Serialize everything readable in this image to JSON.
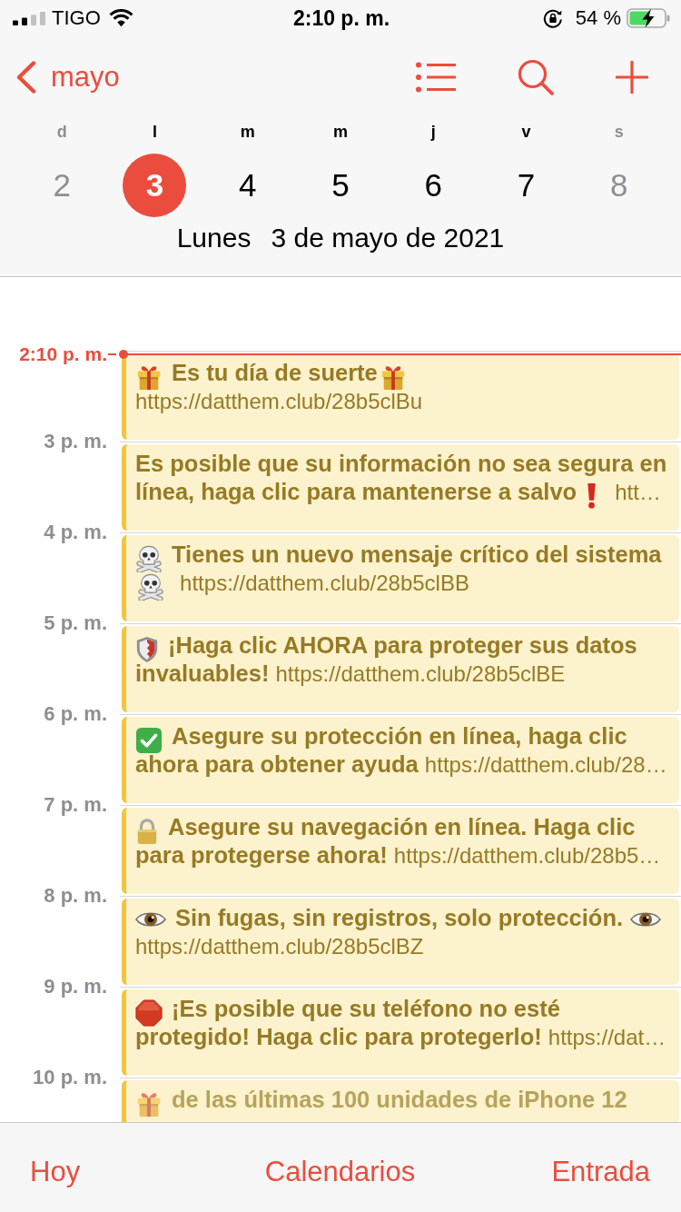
{
  "status_bar": {
    "carrier": "TIGO",
    "time": "2:10 p. m.",
    "battery": "54 %"
  },
  "nav": {
    "back_label": "mayo"
  },
  "week": [
    {
      "letter": "d",
      "day": "2",
      "selected": false,
      "weekend": true
    },
    {
      "letter": "l",
      "day": "3",
      "selected": true,
      "weekend": false
    },
    {
      "letter": "m",
      "day": "4",
      "selected": false,
      "weekend": false
    },
    {
      "letter": "m",
      "day": "5",
      "selected": false,
      "weekend": false
    },
    {
      "letter": "j",
      "day": "6",
      "selected": false,
      "weekend": false
    },
    {
      "letter": "v",
      "day": "7",
      "selected": false,
      "weekend": false
    },
    {
      "letter": "s",
      "day": "8",
      "selected": false,
      "weekend": true
    }
  ],
  "selected_date": {
    "weekday": "Lunes",
    "date": "3 de mayo de 2021"
  },
  "timeline": {
    "current_time": "2:10 p. m.",
    "hours": [
      {
        "event": {
          "dimmed": false,
          "title": [
            {
              "kind": "gift"
            },
            {
              "kind": "text",
              "text": "Es tu día de suerte"
            },
            {
              "kind": "gift"
            }
          ],
          "url": "https://datthem.club/28b5clBu"
        }
      },
      {
        "label": "3 p. m.",
        "event": {
          "dimmed": false,
          "title": [
            {
              "kind": "text",
              "text": "Es posible que su información no sea segura en línea, haga clic para mantenerse a salvo"
            },
            {
              "kind": "exclamation"
            }
          ],
          "url": "htt…"
        }
      },
      {
        "label": "4 p. m.",
        "event": {
          "dimmed": false,
          "title": [
            {
              "kind": "skull"
            },
            {
              "kind": "text",
              "text": "Tienes un nuevo mensaje crítico del sistema"
            },
            {
              "kind": "skull"
            }
          ],
          "url": "https://datthem.club/28b5clBB"
        }
      },
      {
        "label": "5 p. m.",
        "event": {
          "dimmed": false,
          "title": [
            {
              "kind": "shield"
            },
            {
              "kind": "text",
              "text": "¡Haga clic AHORA para proteger sus datos invaluables!"
            }
          ],
          "url": "https://datthem.club/28b5clBE"
        }
      },
      {
        "label": "6 p. m.",
        "event": {
          "dimmed": false,
          "title": [
            {
              "kind": "check"
            },
            {
              "kind": "text",
              "text": "Asegure su protección en línea, haga clic ahora para obtener ayuda"
            }
          ],
          "url": "https://datthem.club/28…"
        }
      },
      {
        "label": "7 p. m.",
        "event": {
          "dimmed": false,
          "title": [
            {
              "kind": "lock"
            },
            {
              "kind": "text",
              "text": "Asegure su navegación en línea. Haga clic para protegerse ahora!"
            }
          ],
          "url": "https://datthem.club/28b5…"
        }
      },
      {
        "label": "8 p. m.",
        "event": {
          "dimmed": false,
          "title": [
            {
              "kind": "eye"
            },
            {
              "kind": "text",
              "text": "Sin fugas, sin registros, solo protección."
            },
            {
              "kind": "eye"
            }
          ],
          "url": "https://datthem.club/28b5clBZ"
        }
      },
      {
        "label": "9 p. m.",
        "event": {
          "dimmed": false,
          "title": [
            {
              "kind": "stop"
            },
            {
              "kind": "text",
              "text": "¡Es posible que su teléfono no esté protegido! Haga clic para protegerlo!"
            }
          ],
          "url": "https://dat…"
        }
      },
      {
        "label": "10 p. m.",
        "event": {
          "dimmed": true,
          "title": [
            {
              "kind": "gift"
            },
            {
              "kind": "text",
              "text": "de las últimas 100 unidades de iPhone 12"
            }
          ]
        }
      }
    ]
  },
  "tab_bar": [
    "Hoy",
    "Calendarios",
    "Entrada"
  ]
}
